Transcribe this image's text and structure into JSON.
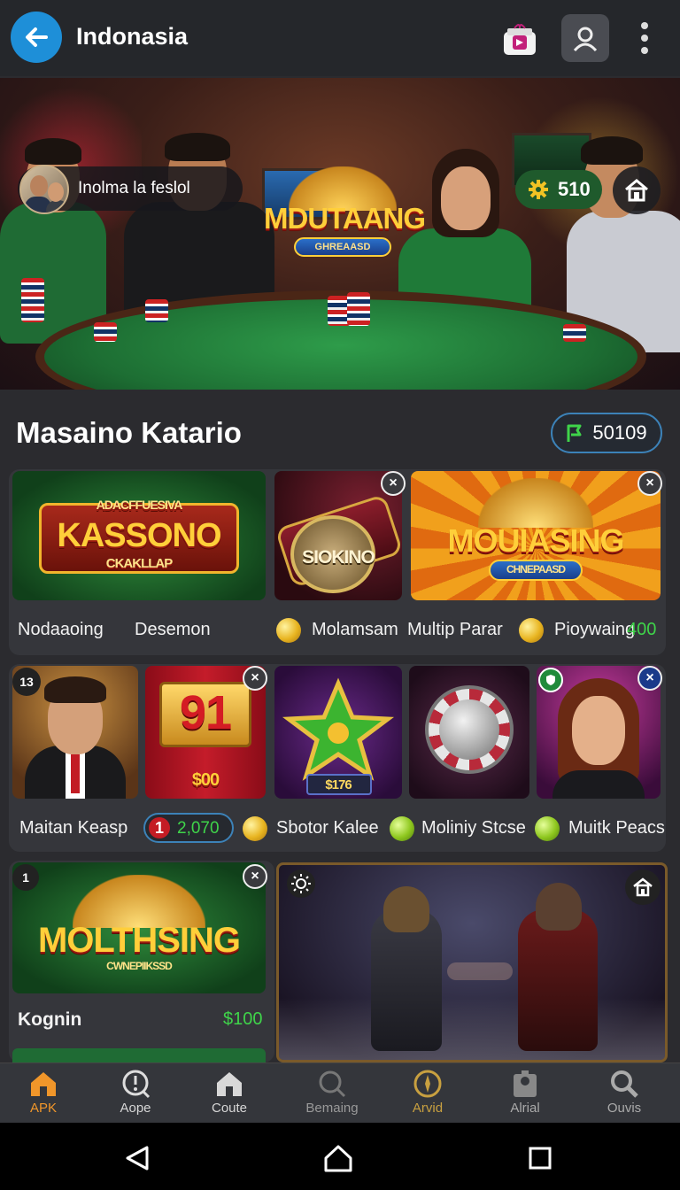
{
  "header": {
    "title": "Indonasia"
  },
  "hero": {
    "user_name": "Inolma la feslol",
    "coins": "510",
    "logo_word": "MDUTAANG",
    "logo_ribbon": "GHREAASD"
  },
  "section": {
    "title": "Masaino Katario",
    "balance": "50109"
  },
  "row1": {
    "tiles": [
      {
        "logo_top": "ADACFFUESIVA",
        "logo_main": "KASSONO",
        "logo_sub": "CKAKLLAP"
      },
      {
        "logo_main": "SIOKINO"
      },
      {
        "logo_main": "MOUIASING",
        "logo_sub": "CHNEPAASD"
      }
    ],
    "labels": [
      "Nodaaoing",
      "Desemon",
      "Molamsam",
      "Multip Parar",
      "Pioywaing"
    ],
    "highlight_value": "400"
  },
  "row2": {
    "badge_left": "13",
    "tile2_number": "91",
    "tile2_amount": "$00",
    "tile3_amount": "$176",
    "labels": [
      "Maitan Keasp",
      "Sbotor Kalee",
      "Moliniy Stcse",
      "Muitk Peacs"
    ],
    "counter_left": "1",
    "counter_value": "2,070"
  },
  "row3": {
    "badge_left": "1",
    "logo_main": "MOLTHSING",
    "logo_sub": "CWNEPIIKSSD",
    "label": "Kognin",
    "price": "$100"
  },
  "bottom_nav": {
    "items": [
      {
        "label": "APK",
        "icon": "home-icon",
        "active": true
      },
      {
        "label": "Aope",
        "icon": "alert-icon"
      },
      {
        "label": "Coute",
        "icon": "house-icon"
      },
      {
        "label": "Bemaing",
        "icon": "search-icon"
      },
      {
        "label": "Arvid",
        "icon": "compass-icon"
      },
      {
        "label": "Alrial",
        "icon": "map-pin-icon"
      },
      {
        "label": "Ouvis",
        "icon": "magnifier-icon"
      }
    ]
  },
  "colors": {
    "accent_blue": "#1e8fd8",
    "active_orange": "#f0962a",
    "highlight_green": "#3fd44a",
    "gold": "#ffcf3a"
  }
}
